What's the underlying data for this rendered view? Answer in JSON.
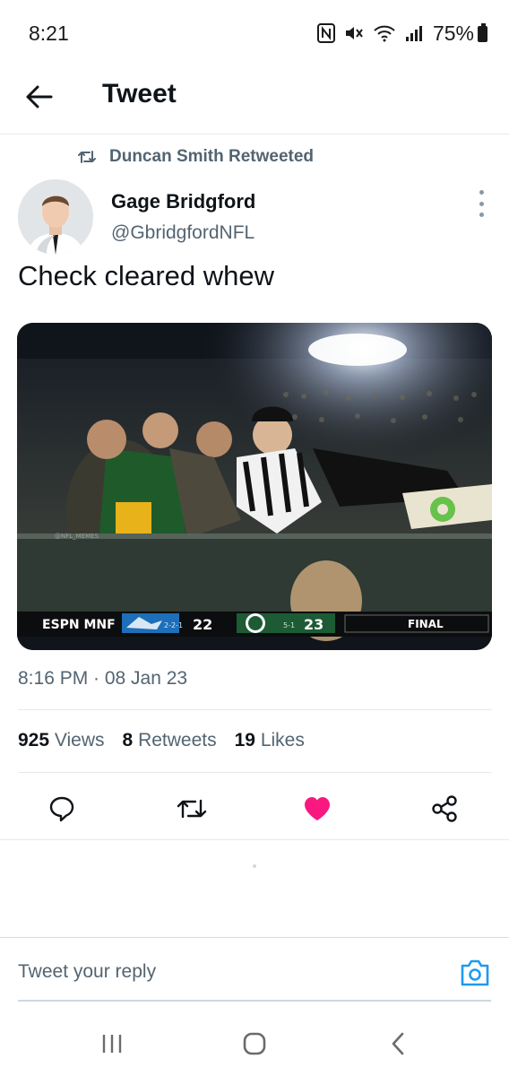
{
  "status_bar": {
    "time": "8:21",
    "battery": "75%"
  },
  "header": {
    "title": "Tweet"
  },
  "retweet_banner": {
    "text": "Duncan Smith Retweeted"
  },
  "author": {
    "name": "Gage Bridgford",
    "handle": "@GbridgfordNFL"
  },
  "tweet": {
    "text": "Check cleared whew",
    "timestamp": "8:16 PM · 08 Jan 23"
  },
  "media": {
    "broadcast": "ESPN MNF",
    "away_record": "2-2-1",
    "away_score": "22",
    "home_record": "5-1",
    "home_score": "23",
    "status": "FINAL"
  },
  "stats": {
    "views_count": "925",
    "views_label": "Views",
    "retweets_count": "8",
    "retweets_label": "Retweets",
    "likes_count": "19",
    "likes_label": "Likes"
  },
  "colors": {
    "like": "#f91880",
    "accent": "#1d9bf0"
  },
  "icons": [
    "back-arrow-icon",
    "retweet-icon",
    "more-vertical-icon",
    "reply-icon",
    "heart-icon",
    "share-icon",
    "camera-icon"
  ],
  "reply": {
    "placeholder": "Tweet your reply"
  }
}
